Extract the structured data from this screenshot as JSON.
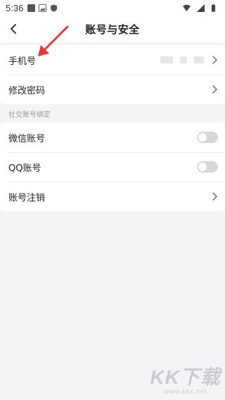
{
  "status_bar": {
    "time": "5:36"
  },
  "nav": {
    "title": "账号与安全"
  },
  "account_group": {
    "phone_label": "手机号",
    "change_password_label": "修改密码"
  },
  "social_section": {
    "header": "社交账号绑定"
  },
  "social_group": {
    "wechat_label": "微信账号",
    "qq_label": "QQ账号",
    "cancel_label": "账号注销"
  },
  "toggles": {
    "wechat_bound": false,
    "qq_bound": false
  },
  "watermark": {
    "logo_text": "KK下载",
    "url": "www.kkx.net"
  },
  "colors": {
    "annotation_arrow": "#e53935",
    "toggle_off": "#d7d7d7",
    "page_bg": "#f4f4f6"
  },
  "icons": [
    "back-arrow-icon",
    "chevron-right-icon",
    "wifi-icon",
    "signal-icon",
    "battery-icon"
  ]
}
